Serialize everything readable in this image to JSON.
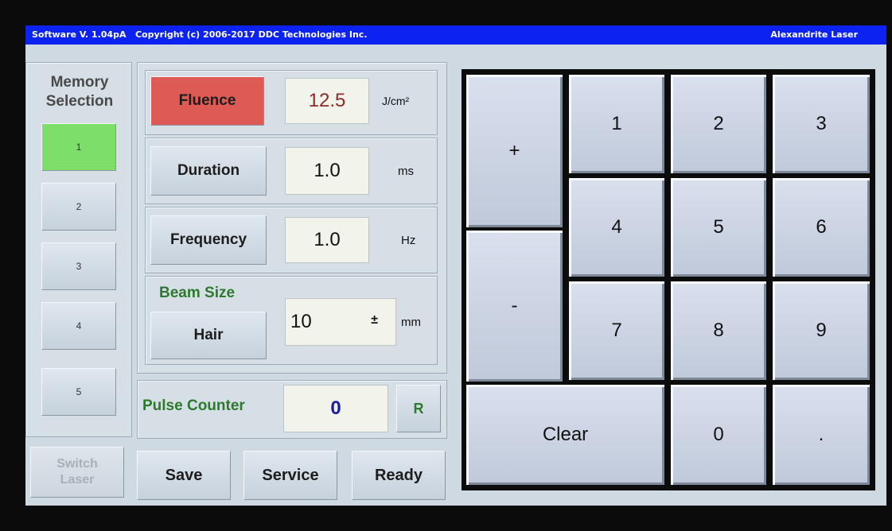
{
  "titlebar": {
    "version": "Software V. 1.04pA",
    "copyright": "Copyright (c) 2006-2017 DDC Technologies Inc.",
    "laser_type": "Alexandrite Laser"
  },
  "memory": {
    "title_line1": "Memory",
    "title_line2": "Selection",
    "slots": [
      "1",
      "2",
      "3",
      "4",
      "5"
    ],
    "selected": "1"
  },
  "params": {
    "fluence": {
      "label": "Fluence",
      "value": "12.5",
      "unit": "J/cm²"
    },
    "duration": {
      "label": "Duration",
      "value": "1.0",
      "unit": "ms"
    },
    "frequency": {
      "label": "Frequency",
      "value": "1.0",
      "unit": "Hz"
    },
    "beam": {
      "title": "Beam Size",
      "mode_label": "Hair",
      "value": "10",
      "dropdown_glyph": "±",
      "unit": "mm"
    }
  },
  "pulse": {
    "label": "Pulse Counter",
    "value": "0",
    "reset_label": "R"
  },
  "bottom": {
    "switch_line1": "Switch",
    "switch_line2": "Laser",
    "save": "Save",
    "service": "Service",
    "ready": "Ready"
  },
  "keypad": {
    "plus": "+",
    "minus": "-",
    "k1": "1",
    "k2": "2",
    "k3": "3",
    "k4": "4",
    "k5": "5",
    "k6": "6",
    "k7": "7",
    "k8": "8",
    "k9": "9",
    "clear": "Clear",
    "k0": "0",
    "dot": "."
  },
  "colors": {
    "titlebar": "#0b22f0",
    "fluence_active": "#dd5a55",
    "memory_selected": "#7dde6a",
    "label_green": "#2c7a2c"
  }
}
